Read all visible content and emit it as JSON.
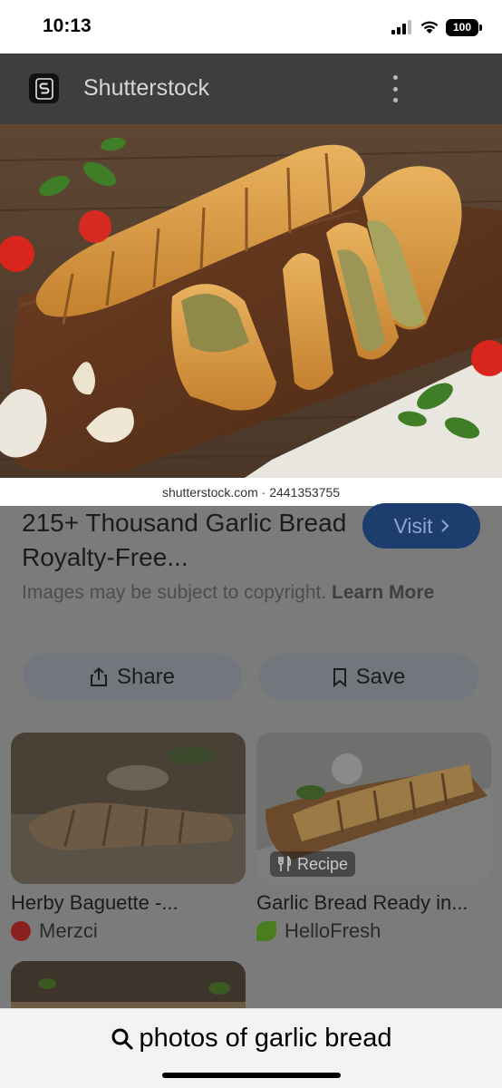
{
  "status_bar": {
    "time": "10:13",
    "battery": "100"
  },
  "header": {
    "site_name": "Shutterstock"
  },
  "hero": {
    "caption": "shutterstock.com · 2441353755"
  },
  "result": {
    "title": "215+ Thousand Garlic Bread Royalty-Free...",
    "visit_label": "Visit",
    "notice_text": "Images may be subject to copyright.",
    "notice_link": "Learn More",
    "share_label": "Share",
    "save_label": "Save"
  },
  "related": [
    {
      "title": "Herby Baguette -...",
      "source": "Merzci",
      "source_color": "#8b2020"
    },
    {
      "title": "Garlic Bread Ready in...",
      "source": "HelloFresh",
      "source_color": "#4a7d1e",
      "badge": "Recipe"
    }
  ],
  "search": {
    "query": "photos of garlic bread"
  },
  "colors": {
    "visit_button": "#1e3d6f",
    "scrim": "#7b7b7b"
  }
}
